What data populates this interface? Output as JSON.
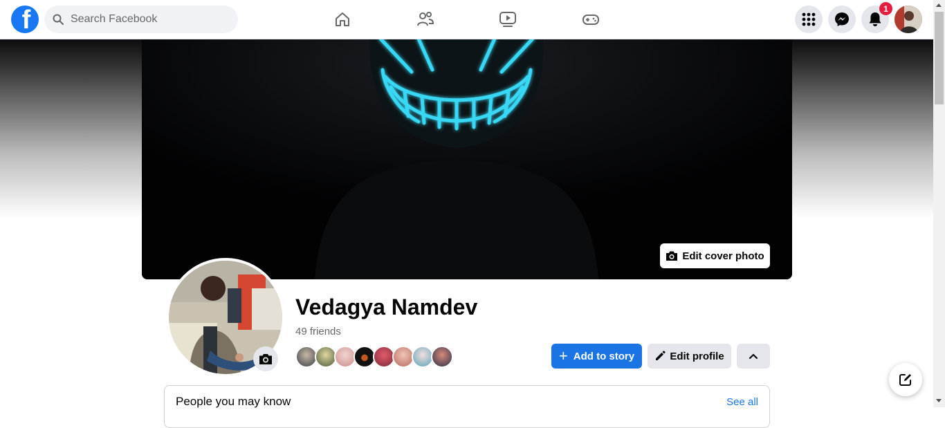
{
  "search": {
    "placeholder": "Search Facebook"
  },
  "nav": {
    "tabs": [
      {
        "name": "home"
      },
      {
        "name": "friends"
      },
      {
        "name": "watch"
      },
      {
        "name": "gaming"
      }
    ]
  },
  "topright": {
    "notifications_count": "1"
  },
  "profile": {
    "name": "Vedagya Namdev",
    "friends_count": "49 friends",
    "edit_cover_label": "Edit cover photo",
    "add_story_label": "Add to story",
    "edit_profile_label": "Edit profile"
  },
  "pymk": {
    "title": "People you may know",
    "see_all": "See all"
  },
  "colors": {
    "brand": "#1877f2",
    "badge": "#e41e3f",
    "primary_button": "#1b74e4",
    "secondary_button": "#e4e6eb"
  }
}
